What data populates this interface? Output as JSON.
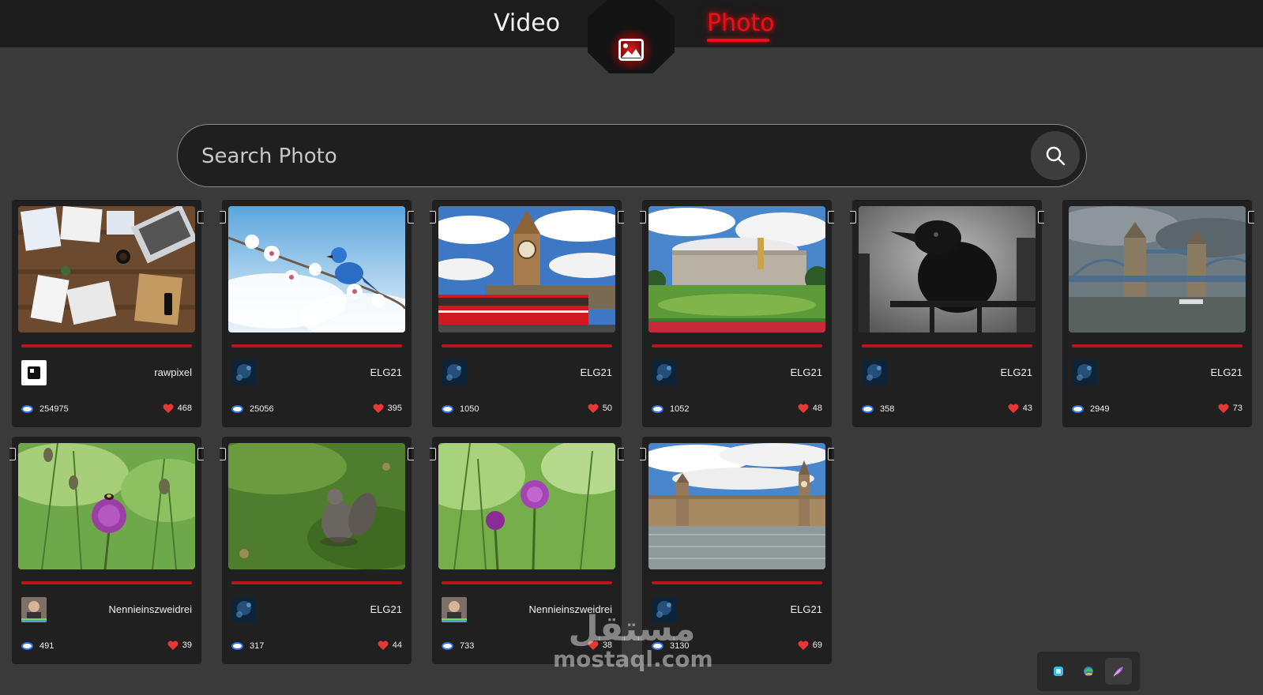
{
  "nav": {
    "video_label": "Video",
    "photo_label": "Photo",
    "center_icon": "image-icon",
    "accent_color": "#e8101a"
  },
  "search": {
    "placeholder": "Search Photo",
    "value": "",
    "icon": "search-icon"
  },
  "cards": [
    {
      "author": "rawpixel",
      "views": "254975",
      "likes": "468",
      "image": "office desk flat lay"
    },
    {
      "author": "ELG21",
      "views": "25056",
      "likes": "395",
      "image": "blue bird on blossom branch"
    },
    {
      "author": "ELG21",
      "views": "1050",
      "likes": "50",
      "image": "big ben with red bus"
    },
    {
      "author": "ELG21",
      "views": "1052",
      "likes": "48",
      "image": "buckingham palace"
    },
    {
      "author": "ELG21",
      "views": "358",
      "likes": "43",
      "image": "crow on railing"
    },
    {
      "author": "ELG21",
      "views": "2949",
      "likes": "73",
      "image": "tower bridge"
    },
    {
      "author": "Nennieinszweidrei",
      "views": "491",
      "likes": "39",
      "image": "purple thistle with bee"
    },
    {
      "author": "ELG21",
      "views": "317",
      "likes": "44",
      "image": "squirrel on grass"
    },
    {
      "author": "Nennieinszweidrei",
      "views": "733",
      "likes": "38",
      "image": "purple thistle flower"
    },
    {
      "author": "ELG21",
      "views": "3130",
      "likes": "69",
      "image": "houses of parliament"
    }
  ],
  "dock": {
    "items": [
      "app-icon-cyan",
      "app-icon-globe",
      "feather-icon"
    ]
  },
  "watermark": {
    "arabic": "مستقل",
    "latin": "mostaql.com"
  }
}
